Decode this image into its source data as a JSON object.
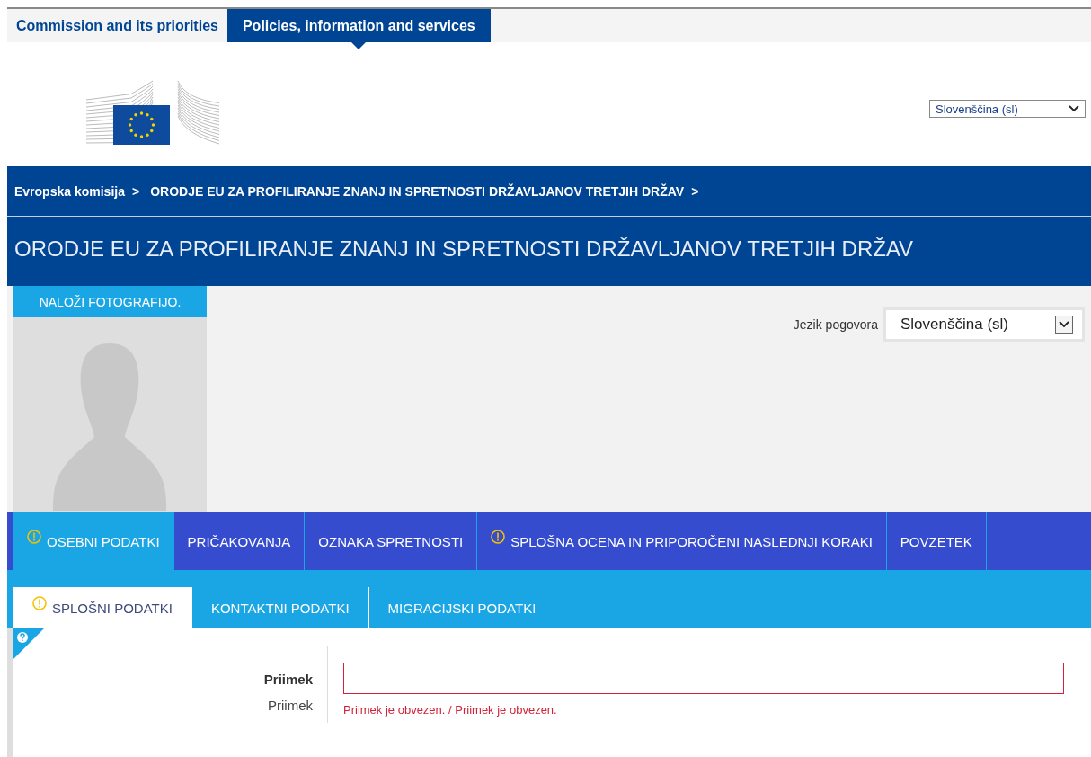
{
  "top_nav": [
    {
      "label": "Commission and its priorities",
      "selected": false
    },
    {
      "label": "Policies, information and services",
      "selected": true
    }
  ],
  "site_language": {
    "value": "Slovenščina (sl)"
  },
  "breadcrumb": [
    {
      "label": "Evropska komisija",
      "separator": ">"
    },
    {
      "label": "ORODJE EU ZA PROFILIRANJE ZNANJ IN SPRETNOSTI DRŽAVLJANOV TRETJIH DRŽAV",
      "separator": ">"
    }
  ],
  "page_title": "ORODJE EU ZA PROFILIRANJE ZNANJ IN SPRETNOSTI DRŽAVLJANOV TRETJIH DRŽAV",
  "upload_button": "NALOŽI FOTOGRAFIJO.",
  "interview_language": {
    "label": "Jezik pogovora",
    "value": "Slovenščina (sl)"
  },
  "main_tabs": [
    {
      "label": "OSEBNI PODATKI",
      "warning": true,
      "selected": true
    },
    {
      "label": "PRIČAKOVANJA",
      "warning": false,
      "selected": false
    },
    {
      "label": "OZNAKA SPRETNOSTI",
      "warning": false,
      "selected": false
    },
    {
      "label": "SPLOŠNA OCENA IN PRIPOROČENI NASLEDNJI KORAKI",
      "warning": true,
      "selected": false
    },
    {
      "label": "POVZETEK",
      "warning": false,
      "selected": false
    }
  ],
  "sub_tabs": [
    {
      "label": "SPLOŠNI PODATKI",
      "warning": true,
      "selected": true
    },
    {
      "label": "KONTAKTNI PODATKI",
      "warning": false,
      "selected": false
    },
    {
      "label": "MIGRACIJSKI PODATKI",
      "warning": false,
      "selected": false
    }
  ],
  "fields": [
    {
      "label": "Priimek",
      "sublabel": "Priimek",
      "invalid": true,
      "error": "Priimek je obvezen. / Priimek je obvezen."
    }
  ]
}
